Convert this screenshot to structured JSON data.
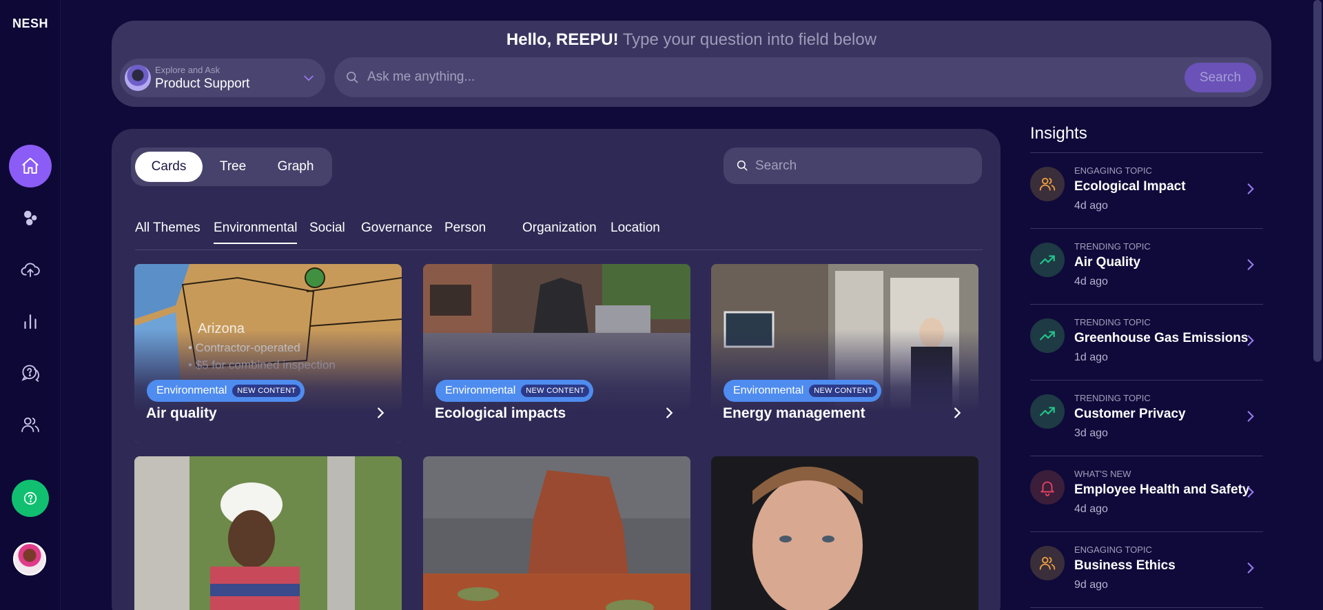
{
  "app": {
    "logo": "NESH"
  },
  "sidebar": {
    "items": [
      {
        "name": "home",
        "icon": "home-icon"
      },
      {
        "name": "topics",
        "icon": "bubbles-icon"
      },
      {
        "name": "upload",
        "icon": "cloud-upload-icon"
      },
      {
        "name": "analytics",
        "icon": "bar-chart-icon"
      },
      {
        "name": "questions",
        "icon": "question-chat-icon"
      },
      {
        "name": "users",
        "icon": "users-icon"
      }
    ],
    "help_icon": "help-icon",
    "accent": "#8b5cf6",
    "help_color": "#10c070"
  },
  "header": {
    "hello": "Hello, REEPU!",
    "subtitle": "Type your question into field below",
    "mode_small": "Explore and Ask",
    "mode_label": "Product Support",
    "ask_placeholder": "Ask me anything...",
    "search_button": "Search"
  },
  "main": {
    "views": [
      "Cards",
      "Tree",
      "Graph"
    ],
    "selected_view": "Cards",
    "search_placeholder": "Search",
    "themes": [
      "All Themes",
      "Environmental",
      "Social",
      "Governance",
      "Person",
      "Organization",
      "Location"
    ],
    "active_theme": "Environmental",
    "cards": [
      {
        "tag": "Environmental",
        "badge": "NEW CONTENT",
        "title": "Air quality"
      },
      {
        "tag": "Environmental",
        "badge": "NEW CONTENT",
        "title": "Ecological impacts"
      },
      {
        "tag": "Environmental",
        "badge": "NEW CONTENT",
        "title": "Energy management"
      },
      {
        "tag": "",
        "badge": "",
        "title": ""
      },
      {
        "tag": "",
        "badge": "",
        "title": ""
      },
      {
        "tag": "",
        "badge": "",
        "title": ""
      }
    ]
  },
  "insights": {
    "title": "Insights",
    "items": [
      {
        "kind": "ENGAGING TOPIC",
        "name": "Ecological Impact",
        "time": "4d ago",
        "icon": "users-icon",
        "color": "#f0a040"
      },
      {
        "kind": "TRENDING TOPIC",
        "name": "Air Quality",
        "time": "4d ago",
        "icon": "trending-up-icon",
        "color": "#22c58a"
      },
      {
        "kind": "TRENDING TOPIC",
        "name": "Greenhouse Gas Emissions",
        "time": "1d ago",
        "icon": "trending-up-icon",
        "color": "#22c58a"
      },
      {
        "kind": "TRENDING TOPIC",
        "name": "Customer Privacy",
        "time": "3d ago",
        "icon": "trending-up-icon",
        "color": "#22c58a"
      },
      {
        "kind": "WHAT'S NEW",
        "name": "Employee Health and Safety",
        "time": "4d ago",
        "icon": "bell-icon",
        "color": "#e04060"
      },
      {
        "kind": "ENGAGING TOPIC",
        "name": "Business Ethics",
        "time": "9d ago",
        "icon": "users-icon",
        "color": "#f0a040"
      }
    ]
  }
}
